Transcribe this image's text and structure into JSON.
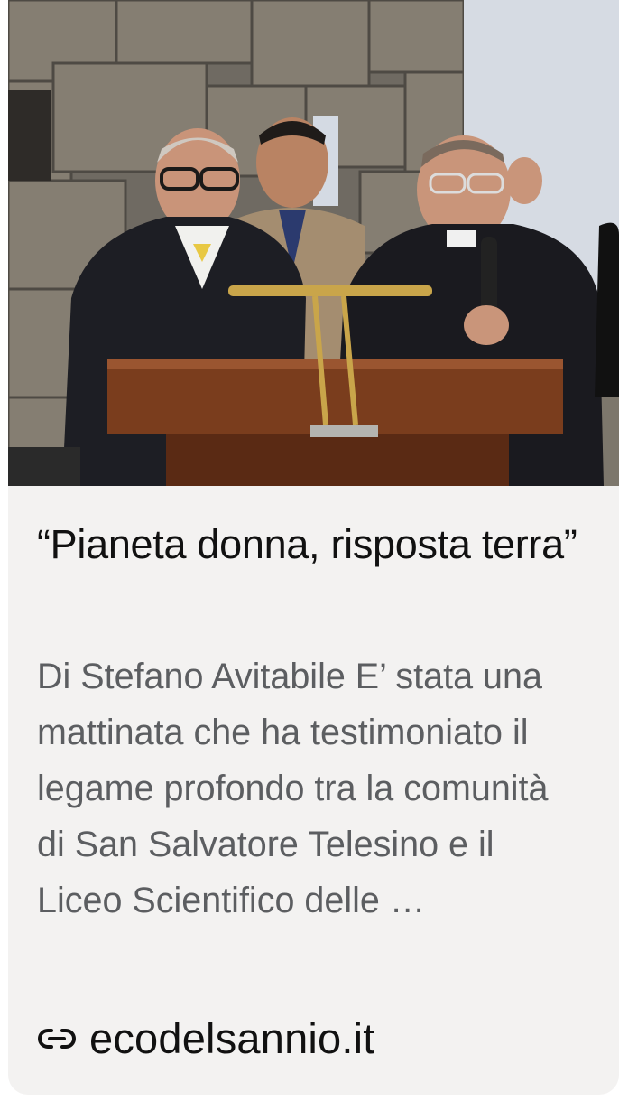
{
  "card": {
    "image": {
      "description_icon": "photo-thumbnail",
      "colors": {
        "stone_wall": "#7b756b",
        "wood": "#7a3e1f",
        "brass": "#c9a54a",
        "sky_panel": "#d7dde6"
      }
    },
    "headline": "“Pianeta donna, risposta terra”",
    "snippet": "Di Stefano Avitabile E’ stata una mattinata che ha testimoniato il legame profondo tra la comunità di San Salvatore Telesino e il Liceo Scientifico delle …",
    "source": {
      "icon": "link-icon",
      "domain": "ecodelsannio.it"
    }
  }
}
